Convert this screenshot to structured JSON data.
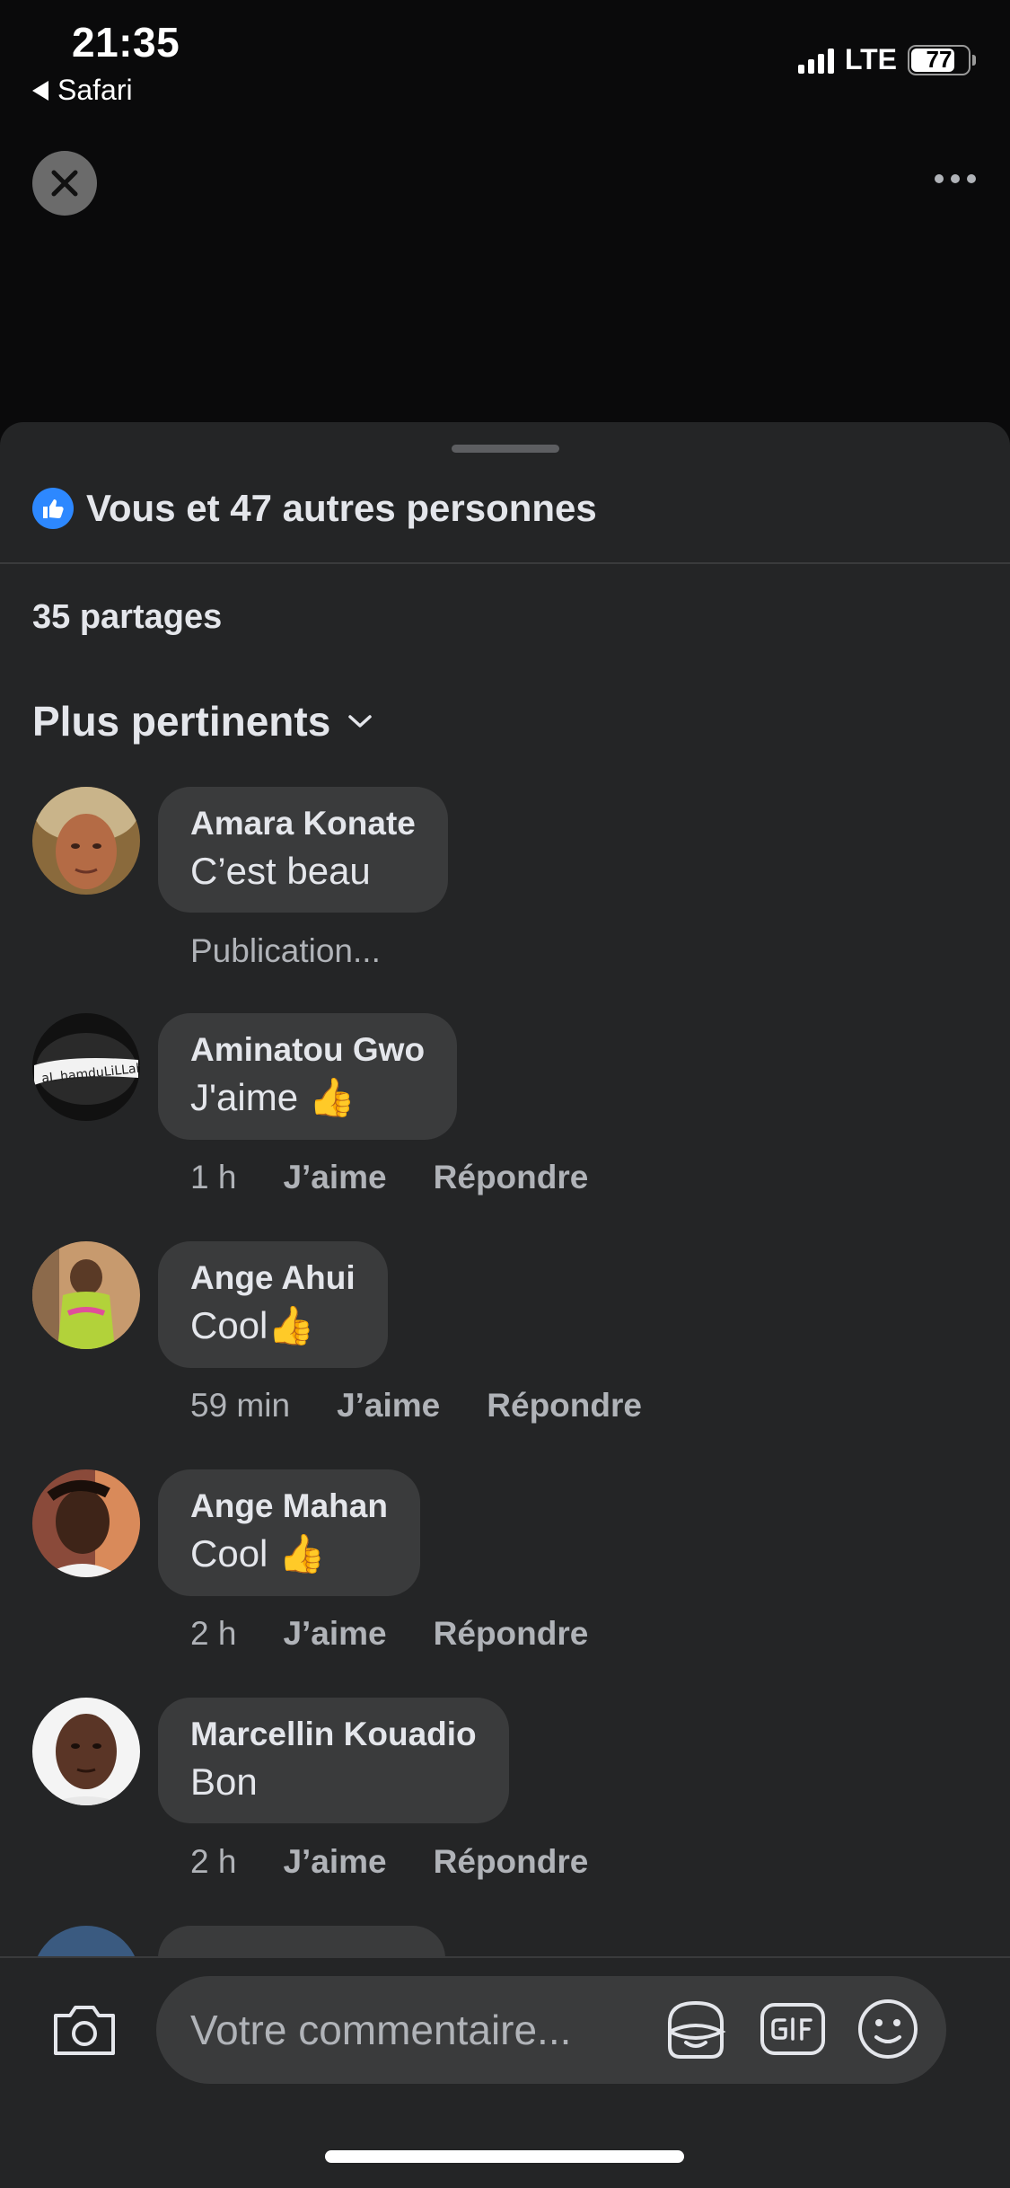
{
  "status_bar": {
    "time": "21:35",
    "back_app": "Safari",
    "network": "LTE",
    "battery": "77",
    "battery_level": 0.77
  },
  "sheet": {
    "reactions_text": "Vous et 47 autres personnes",
    "shares_text": "35 partages",
    "sort_label": "Plus pertinents"
  },
  "comments": [
    {
      "name": "Amara Konate",
      "text": "C’est beau",
      "time": "",
      "like": "",
      "reply": "",
      "status": "Publication..."
    },
    {
      "name": "Aminatou Gwo",
      "text": "J'aime 👍",
      "time": "1 h",
      "like": "J’aime",
      "reply": "Répondre"
    },
    {
      "name": "Ange Ahui",
      "text": "Cool👍",
      "time": "59 min",
      "like": "J’aime",
      "reply": "Répondre"
    },
    {
      "name": "Ange Mahan",
      "text": "Cool 👍",
      "time": "2 h",
      "like": "J’aime",
      "reply": "Répondre"
    },
    {
      "name": "Marcellin Kouadio",
      "text": "Bon",
      "time": "2 h",
      "like": "J’aime",
      "reply": "Répondre"
    }
  ],
  "avatar_2_text": "aL hamduLiLLah",
  "input": {
    "placeholder": "Votre commentaire..."
  },
  "colors": {
    "background": "#0a0a0b",
    "sheet": "#242526",
    "bubble": "#3a3b3c",
    "accent": "#2d88ff",
    "text_primary": "#e4e6eb",
    "text_secondary": "#b0b3b8"
  }
}
